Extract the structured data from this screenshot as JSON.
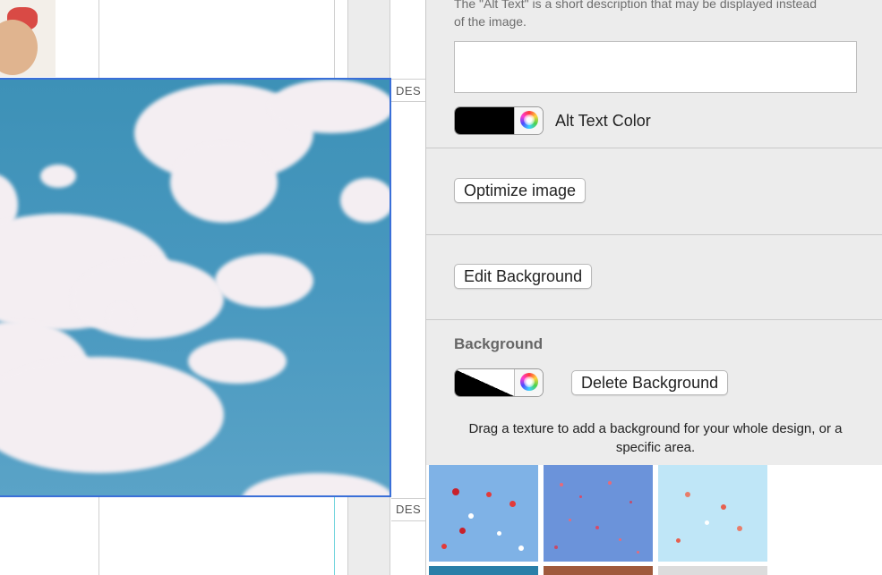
{
  "canvas": {
    "section_labels": [
      "DES",
      "DES"
    ]
  },
  "inspector": {
    "alt_text": {
      "description": "The \"Alt Text\" is a short description that may be displayed instead of the image.",
      "value": "",
      "color_label": "Alt Text Color",
      "color": "#000000"
    },
    "optimize_button": "Optimize image",
    "edit_background_button": "Edit Background",
    "background": {
      "heading": "Background",
      "delete_button": "Delete Background",
      "drag_hint": "Drag a texture to add a background for your whole design, or a specific area."
    },
    "textures": [
      {
        "icon": "balloons-red-on-blue-texture"
      },
      {
        "icon": "confetti-on-blue-texture"
      },
      {
        "icon": "balloons-on-light-blue-texture"
      }
    ]
  },
  "colors": {
    "panel_bg": "#ececec",
    "selection_border": "#3a6fd8",
    "sky_blue": "#4898bf"
  }
}
